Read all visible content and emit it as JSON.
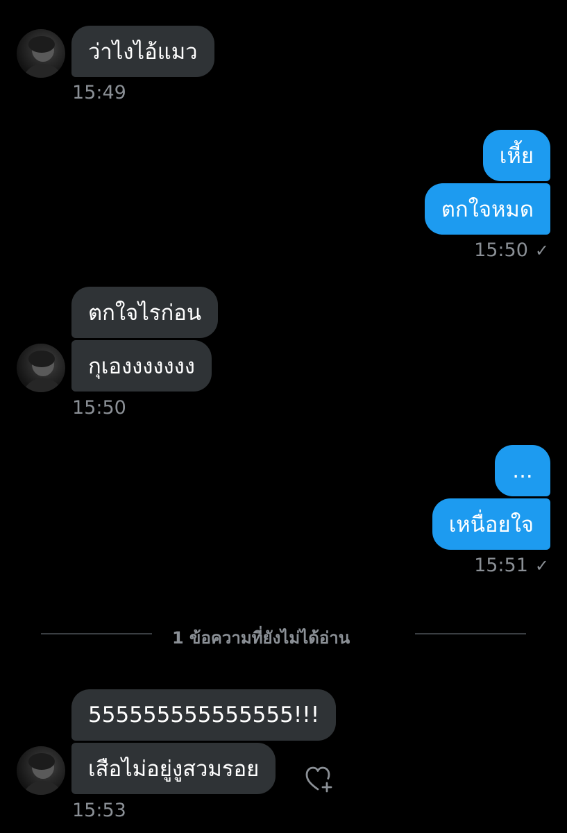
{
  "conversation": {
    "messages": [
      {
        "direction": "in",
        "text": "ว่าไงไอ้แมว"
      },
      {
        "direction": "out",
        "text": "เหี้ย"
      },
      {
        "direction": "out",
        "text": "ตกใจหมด"
      },
      {
        "direction": "in",
        "text": "ตกใจไรก่อน"
      },
      {
        "direction": "in",
        "text": "กุเองงงงงงง"
      },
      {
        "direction": "out",
        "text": "..."
      },
      {
        "direction": "out",
        "text": "เหนื่อยใจ"
      },
      {
        "direction": "in",
        "text": "555555555555555!!!"
      },
      {
        "direction": "in",
        "text": "เสือไม่อยู่งูสวมรอย"
      }
    ],
    "timestamps": [
      "15:49",
      "15:50",
      "15:50",
      "15:51",
      "15:53"
    ],
    "read_check": "✓",
    "unread_divider": "1 ข้อความที่ยังไม่ได้อ่าน"
  },
  "icons": {
    "avatar": "profile-avatar-icon",
    "react": "heart-plus-icon",
    "read_receipt": "checkmark-icon"
  },
  "colors": {
    "background": "#000000",
    "incoming_bubble": "#2f3336",
    "outgoing_bubble": "#1d9bf0",
    "timestamp": "#8b9096"
  }
}
